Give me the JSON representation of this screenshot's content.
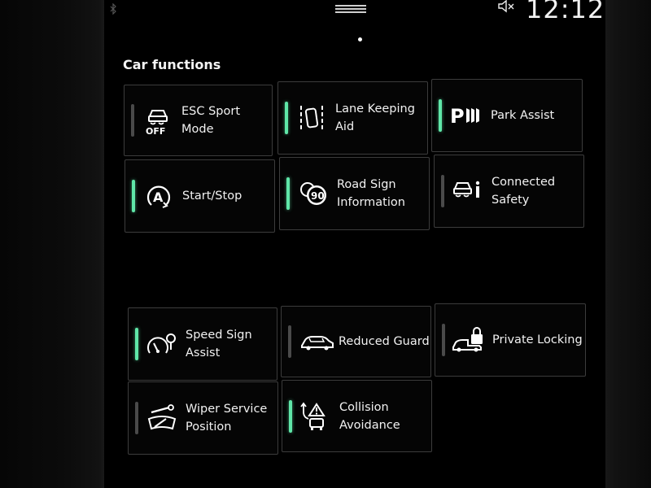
{
  "status_bar": {
    "time": "12:12",
    "icons": [
      "bluetooth-icon",
      "menu-handle-icon",
      "mute-icon"
    ]
  },
  "section": {
    "title": "Car functions"
  },
  "colors": {
    "indicator_on": "#5fe6a8",
    "indicator_off": "#4a4a4a",
    "tile_border": "#3c3c3c",
    "background": "#000000"
  },
  "tiles": [
    {
      "label": "ESC Sport Mode",
      "icon": "esc-off-icon",
      "active": false
    },
    {
      "label": "Lane Keeping\nAid",
      "icon": "lane-keeping-icon",
      "active": true
    },
    {
      "label": "Park Assist",
      "icon": "park-assist-icon",
      "active": true
    },
    {
      "label": "Start/Stop",
      "icon": "start-stop-icon",
      "active": true
    },
    {
      "label": "Road Sign\nInformation",
      "icon": "road-sign-icon",
      "active": true
    },
    {
      "label": "Connected\nSafety",
      "icon": "connected-safety-icon",
      "active": false
    },
    {
      "label": "Speed Sign\nAssist",
      "icon": "speed-sign-assist-icon",
      "active": true
    },
    {
      "label": "Reduced Guard",
      "icon": "reduced-guard-icon",
      "active": false
    },
    {
      "label": "Private Locking",
      "icon": "private-locking-icon",
      "active": false
    },
    {
      "label": "Wiper Service\nPosition",
      "icon": "wiper-service-icon",
      "active": false
    },
    {
      "label": "Collision\nAvoidance",
      "icon": "collision-avoidance-icon",
      "active": true
    }
  ]
}
